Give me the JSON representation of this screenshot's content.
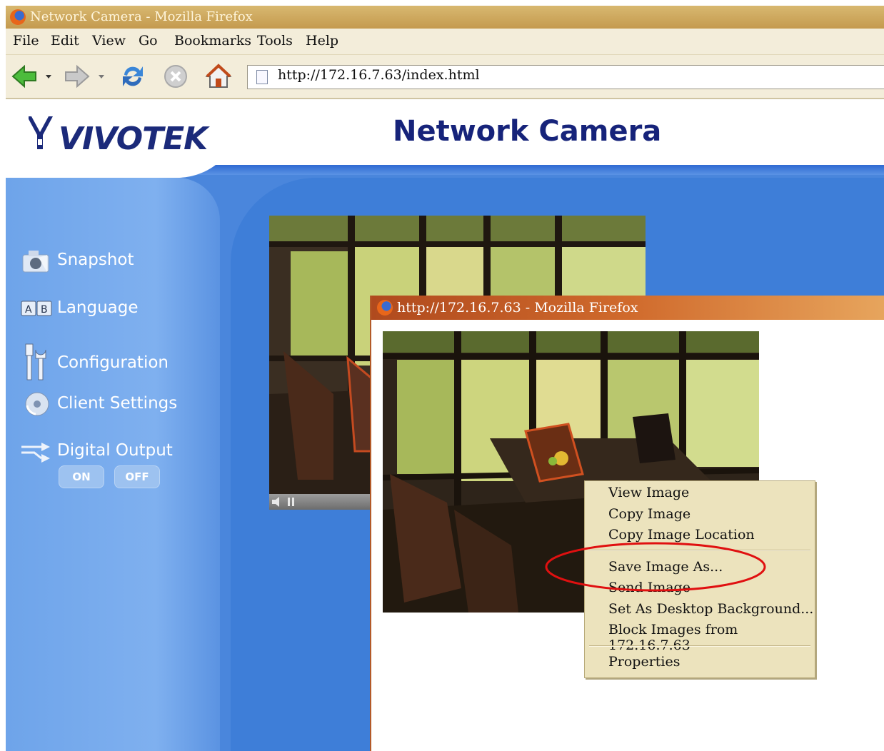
{
  "window": {
    "title": "Network Camera - Mozilla Firefox"
  },
  "menu": [
    {
      "label": "File"
    },
    {
      "label": "Edit"
    },
    {
      "label": "View"
    },
    {
      "label": "Go"
    },
    {
      "label": "Bookmarks"
    },
    {
      "label": "Tools"
    },
    {
      "label": "Help"
    }
  ],
  "toolbar": {
    "url": "http://172.16.7.63/index.html",
    "icons": [
      "back-arrow-icon",
      "forward-arrow-icon",
      "reload-icon",
      "stop-icon",
      "home-icon"
    ]
  },
  "header": {
    "logo": "VIVOTEK",
    "title": "Network Camera"
  },
  "sidebar": {
    "items": [
      {
        "label": "Snapshot",
        "icon": "camera-icon"
      },
      {
        "label": "Language",
        "icon": "language-icon"
      },
      {
        "label": "Configuration",
        "icon": "tools-icon"
      },
      {
        "label": "Client Settings",
        "icon": "disc-icon"
      },
      {
        "label": "Digital Output",
        "icon": "output-icon"
      }
    ],
    "output_on": "ON",
    "output_off": "OFF"
  },
  "popup": {
    "title": "http://172.16.7.63 - Mozilla Firefox"
  },
  "context_menu": {
    "items": [
      "View Image",
      "Copy Image",
      "Copy Image Location",
      "Save Image As...",
      "Send Image",
      "Set As Desktop Background...",
      "Block Images from 172.16.7.63",
      "Properties"
    ]
  },
  "colors": {
    "page_blue": "#4a86dc",
    "title_navy": "#16237a",
    "highlight_ellipse": "#e01010",
    "menu_bg": "#ece3bd"
  }
}
